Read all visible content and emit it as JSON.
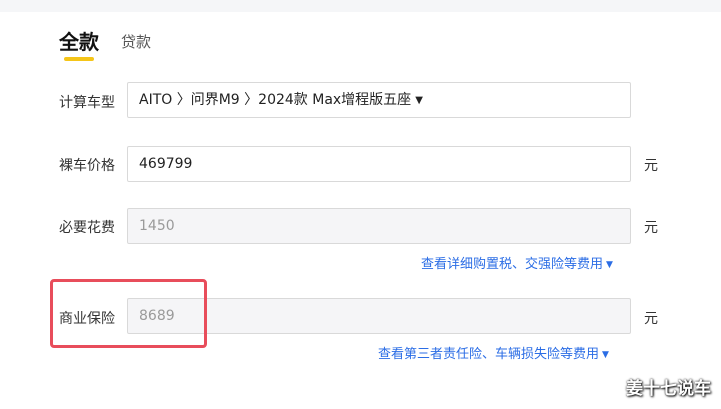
{
  "tabs": [
    {
      "label": "全款",
      "active": true
    },
    {
      "label": "贷款",
      "active": false
    }
  ],
  "form": {
    "model": {
      "label": "计算车型",
      "value": "AITO 〉问界M9 〉2024款 Max增程版五座"
    },
    "bare_price": {
      "label": "裸车价格",
      "value": "469799",
      "unit": "元"
    },
    "necessary_cost": {
      "label": "必要花费",
      "placeholder": "1450",
      "unit": "元",
      "link": "查看详细购置税、交强险等费用"
    },
    "commercial_insurance": {
      "label": "商业保险",
      "placeholder": "8689",
      "unit": "元",
      "link": "查看第三者责任险、车辆损失险等费用"
    }
  },
  "watermark": "姜十七说车",
  "colors": {
    "accent_underline": "#f5c518",
    "link": "#2b6de5",
    "highlight": "#e84d5b"
  }
}
